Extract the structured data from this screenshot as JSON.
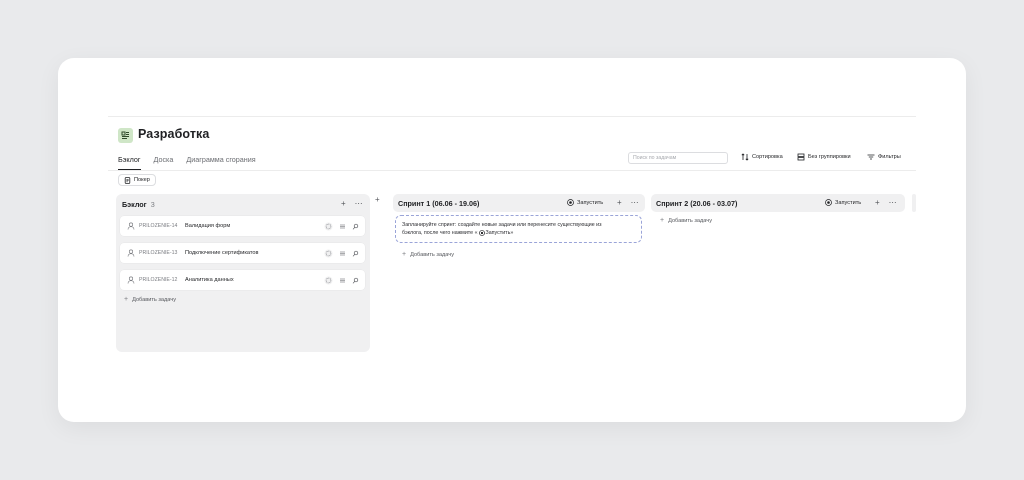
{
  "board": {
    "title": "Разработка",
    "tabs": [
      {
        "label": "Бэклог",
        "active": true
      },
      {
        "label": "Доска",
        "active": false
      },
      {
        "label": "Диаграмма сгорания",
        "active": false
      }
    ],
    "search_placeholder": "Поиск по задачам",
    "toolbar": {
      "sort_label": "Сортировка",
      "group_label": "Без группировки",
      "filter_label": "Фильтры"
    },
    "poker_label": "Покер"
  },
  "backlog": {
    "title": "Бэклог",
    "count": "3",
    "tasks": [
      {
        "key": "PRILOZENIE-14",
        "name": "Валидация форм"
      },
      {
        "key": "PRILOZENIE-13",
        "name": "Подключение сертификатов"
      },
      {
        "key": "PRILOZENIE-12",
        "name": "Аналитика данных"
      }
    ],
    "add_label": "Добавить задачу"
  },
  "sprints": [
    {
      "title": "Спринт 1 (06.06 - 19.06)",
      "start_label": "Запустить",
      "hint_line1": "Запланируйте спринт: создайте новые задачи или перенесите существующие из",
      "hint_line2_pre": "бэклога, после чего нажмите «",
      "hint_line2_btn": "Запустить»",
      "add_label": "Добавить задачу"
    },
    {
      "title": "Спринт 2 (20.06 - 03.07)",
      "start_label": "Запустить",
      "add_label": "Добавить задачу"
    }
  ],
  "colors": {
    "background": "#e9eaec",
    "column": "#f0f0f1",
    "app_icon": "#cfe6c7",
    "hint_border": "#9aa4d8"
  }
}
